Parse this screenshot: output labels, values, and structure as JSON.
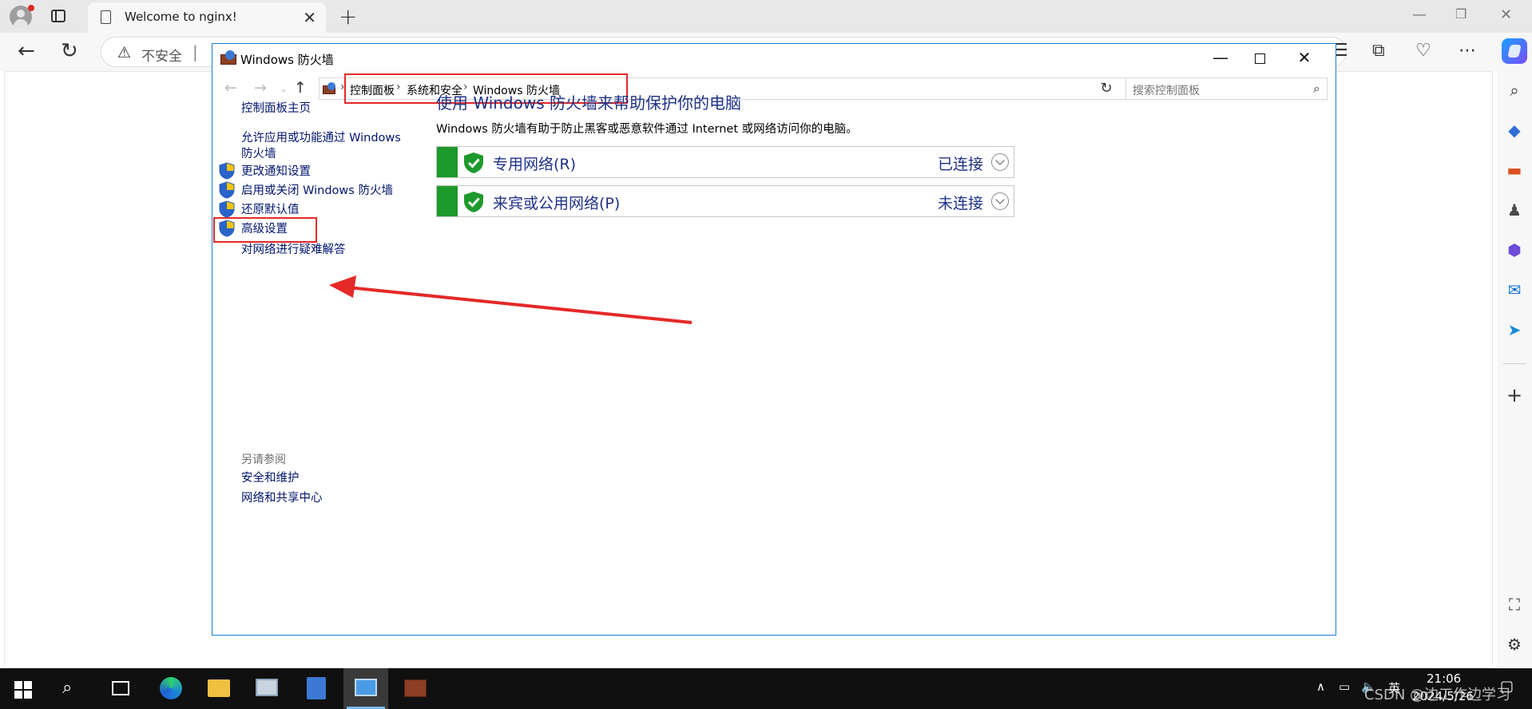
{
  "browser": {
    "tab_title": "Welcome to nginx!",
    "address_warning": "不安全"
  },
  "window": {
    "title": "Windows 防火墙",
    "breadcrumb": [
      "控制面板",
      "系统和安全",
      "Windows 防火墙"
    ],
    "search_placeholder": "搜索控制面板"
  },
  "left_nav": {
    "home": "控制面板主页",
    "allow_app": "允许应用或功能通过 Windows 防火墙",
    "notifications": "更改通知设置",
    "toggle": "启用或关闭 Windows 防火墙",
    "restore": "还原默认值",
    "advanced": "高级设置",
    "troubleshoot": "对网络进行疑难解答",
    "see_also": "另请参阅",
    "security_maintenance": "安全和维护",
    "network_center": "网络和共享中心"
  },
  "main": {
    "heading": "使用 Windows 防火墙来帮助保护你的电脑",
    "description": "Windows 防火墙有助于防止黑客或恶意软件通过 Internet 或网络访问你的电脑。",
    "networks": [
      {
        "name": "专用网络(R)",
        "status": "已连接"
      },
      {
        "name": "来宾或公用网络(P)",
        "status": "未连接"
      }
    ]
  },
  "taskbar": {
    "time": "21:06",
    "date": "2024/5/26",
    "ime": "英",
    "watermark": "CSDN @边工作边学习"
  },
  "colors": {
    "highlight_red": "#e52828",
    "link_blue": "#1e3287",
    "firewall_green": "#1d9a2c"
  }
}
